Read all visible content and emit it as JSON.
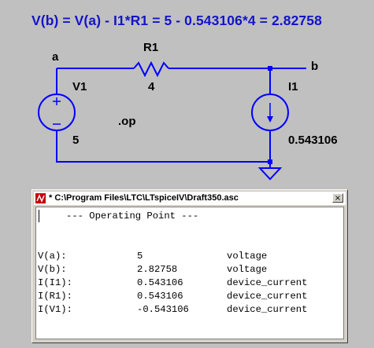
{
  "schematic": {
    "equation": "V(b) = V(a) - I1*R1 = 5 - 0.543106*4 = 2.82758",
    "node_a": "a",
    "node_b": "b",
    "r1_name": "R1",
    "r1_value": "4",
    "v1_name": "V1",
    "v1_value": "5",
    "i1_name": "I1",
    "i1_value": "0.543106",
    "directive": ".op",
    "wire_color": "#0000ff",
    "equation_color": "#1414c8"
  },
  "window": {
    "title": "* C:\\Program Files\\LTC\\LTspiceIV\\Draft350.asc",
    "close_label": "×",
    "header": "--- Operating Point ---",
    "rows": [
      {
        "name": "V(a):",
        "value": "5",
        "type": "voltage"
      },
      {
        "name": "V(b):",
        "value": "2.82758",
        "type": "voltage"
      },
      {
        "name": "I(I1):",
        "value": "0.543106",
        "type": "device_current"
      },
      {
        "name": "I(R1):",
        "value": "0.543106",
        "type": "device_current"
      },
      {
        "name": "I(V1):",
        "value": "-0.543106",
        "type": "device_current"
      }
    ]
  }
}
